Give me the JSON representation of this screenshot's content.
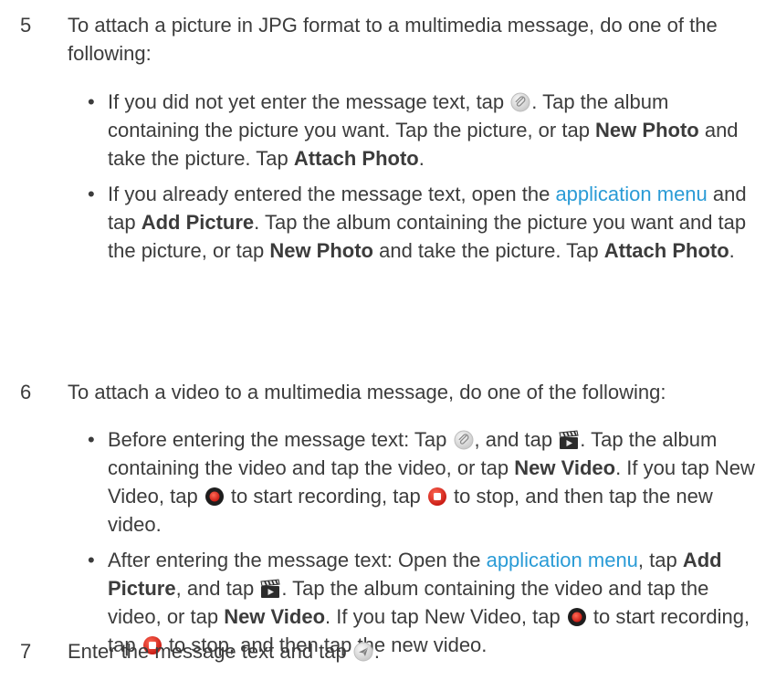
{
  "steps": [
    {
      "number": "5",
      "intro": "To attach a picture in JPG format to a multimedia message, do one of the following:",
      "bullets": [
        {
          "a": "If you did not yet enter the message text, tap ",
          "b": ". Tap the album containing the picture you want. Tap the picture, or tap ",
          "new_photo": "New Photo",
          "c": " and take the picture. Tap ",
          "attach_photo": "Attach Photo",
          "d": "."
        },
        {
          "a": "If you already entered the message text, open the ",
          "link": "application menu",
          "b": " and tap ",
          "add_picture": "Add Picture",
          "c": ". Tap the album containing the picture you want and tap the picture, or tap ",
          "new_photo": "New Photo",
          "d": " and take the picture. Tap ",
          "attach_photo": "Attach Photo",
          "e": "."
        }
      ]
    },
    {
      "number": "6",
      "intro": "To attach a video to a multimedia message, do one of the following:",
      "bullets": [
        {
          "a": "Before entering the message text: Tap ",
          "b": ", and tap ",
          "c": ". Tap the album containing the video and tap the video, or tap ",
          "new_video": "New Video",
          "d": ". If you tap New Video, tap ",
          "e": " to start recording, tap ",
          "f": " to stop, and then tap the new video."
        },
        {
          "a": "After entering the message text: Open the ",
          "link": "application menu",
          "b": ", tap ",
          "add_picture": "Add Picture",
          "c": ", and tap ",
          "d": ". Tap the album containing the video and tap the video, or tap ",
          "new_video": "New Video",
          "e": ". If you tap New Video, tap ",
          "f": " to start recording, tap ",
          "g": " to stop, and then tap the new video."
        }
      ]
    },
    {
      "number": "7",
      "a": "Enter the message text and tap ",
      "b": "."
    }
  ],
  "icons": {
    "attach": "paperclip-icon",
    "video": "clapperboard-icon",
    "record": "record-icon",
    "stop": "stop-icon",
    "send": "send-icon"
  },
  "colors": {
    "link": "#2a9bd6",
    "record": "#d8221f",
    "text": "#3c3c3c"
  }
}
